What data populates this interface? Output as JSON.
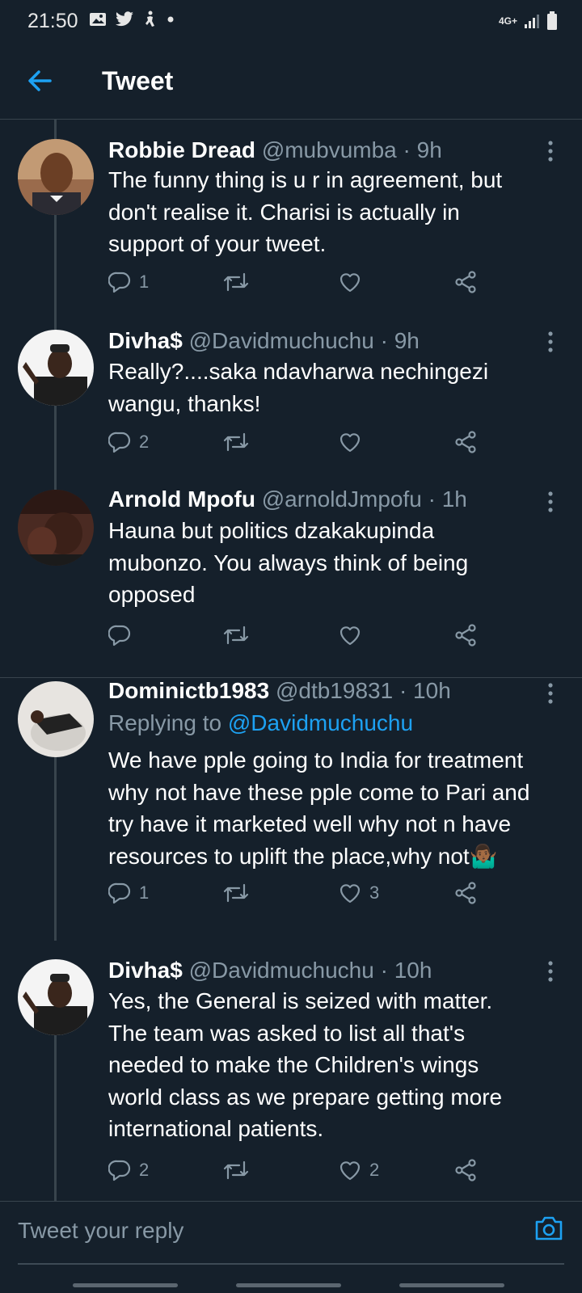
{
  "status_bar": {
    "time": "21:50",
    "network": "4G+",
    "left_icons": [
      "image-icon",
      "twitter-icon",
      "accessibility-icon",
      "dot-icon"
    ],
    "right_icons": [
      "signal-icon",
      "battery-icon"
    ]
  },
  "header": {
    "title": "Tweet",
    "back_icon": "arrow-left-icon"
  },
  "colors": {
    "background": "#15202b",
    "accent": "#1da1f2",
    "secondary_text": "#8899a6",
    "divider": "#38444d"
  },
  "tweets": [
    {
      "name": "Robbie Dread",
      "meta": "@mubvumba · 9h",
      "reply_to_label": "",
      "reply_to_handle": "",
      "text_lines": [
        "The funny thing is u r in agreement, but",
        "don't realise it. Charisi is actually in",
        "support of your tweet."
      ],
      "reply_count": "1",
      "retweet_count": "",
      "like_count": ""
    },
    {
      "name": "Divha$",
      "meta": "@Davidmuchuchu · 9h",
      "reply_to_label": "",
      "reply_to_handle": "",
      "text_lines": [
        "Really?....saka ndavharwa nechingezi",
        "wangu, thanks!"
      ],
      "reply_count": "2",
      "retweet_count": "",
      "like_count": ""
    },
    {
      "name": "Arnold Mpofu",
      "meta": "@arnoldJmpofu · 1h",
      "reply_to_label": "",
      "reply_to_handle": "",
      "text_lines": [
        "Hauna but politics dzakakupinda",
        "mubonzo. You always think of being",
        "opposed"
      ],
      "reply_count": "",
      "retweet_count": "",
      "like_count": ""
    },
    {
      "name": "Dominictb1983",
      "meta": "@dtb19831 · 10h",
      "reply_to_label": "Replying to ",
      "reply_to_handle": "@Davidmuchuchu",
      "text_lines": [
        "We have pple going to India for treatment",
        "why not have these pple come to Pari and",
        "try have it marketed well why not n have",
        "resources to uplift the place,why not🤷🏾‍♂️"
      ],
      "reply_count": "1",
      "retweet_count": "",
      "like_count": "3"
    },
    {
      "name": "Divha$",
      "meta": "@Davidmuchuchu · 10h",
      "reply_to_label": "",
      "reply_to_handle": "",
      "text_lines": [
        "Yes, the General is seized with matter.",
        "The team was asked to list all that's",
        "needed to make the Children's wings",
        "world class as we prepare getting more",
        "international patients."
      ],
      "reply_count": "2",
      "retweet_count": "",
      "like_count": "2"
    }
  ],
  "reply_bar": {
    "placeholder": "Tweet your reply",
    "camera_icon": "camera-icon"
  }
}
